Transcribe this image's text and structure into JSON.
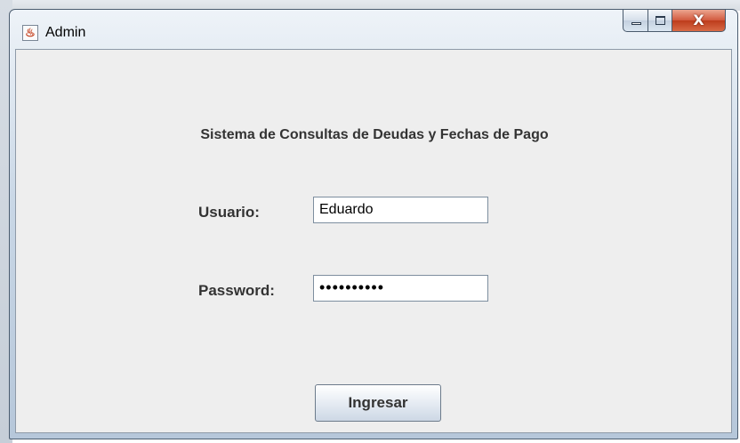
{
  "window": {
    "title": "Admin",
    "app_icon": "java-cup-icon",
    "caption_buttons": [
      "minimize-icon",
      "maximize-icon",
      "close-icon"
    ],
    "close_glyph": "X"
  },
  "form": {
    "heading": "Sistema de Consultas de Deudas y Fechas de Pago",
    "user_label": "Usuario:",
    "user_value": "Eduardo",
    "password_label": "Password:",
    "password_value": "••••••••••",
    "submit_label": "Ingresar"
  },
  "colors": {
    "label_text": "#333333",
    "panel_bg": "#eeeeee",
    "close_button": "#c9472a"
  }
}
